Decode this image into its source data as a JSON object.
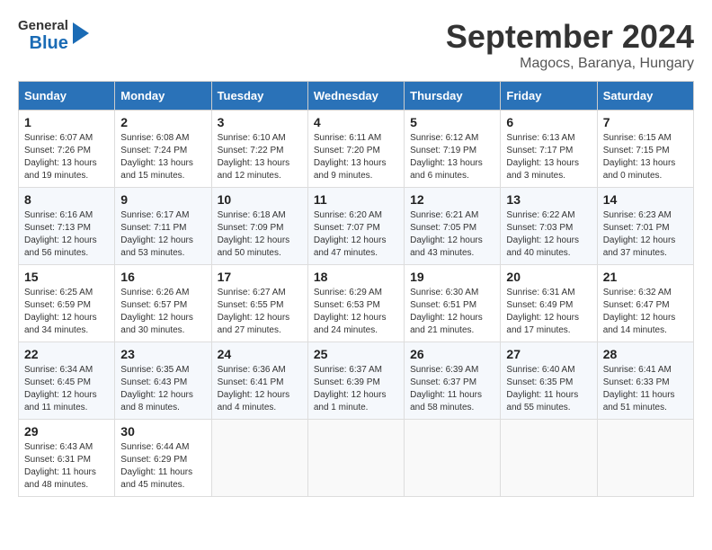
{
  "header": {
    "logo_general": "General",
    "logo_blue": "Blue",
    "month_title": "September 2024",
    "subtitle": "Magocs, Baranya, Hungary"
  },
  "columns": [
    "Sunday",
    "Monday",
    "Tuesday",
    "Wednesday",
    "Thursday",
    "Friday",
    "Saturday"
  ],
  "weeks": [
    [
      {
        "day": "1",
        "info": "Sunrise: 6:07 AM\nSunset: 7:26 PM\nDaylight: 13 hours\nand 19 minutes."
      },
      {
        "day": "2",
        "info": "Sunrise: 6:08 AM\nSunset: 7:24 PM\nDaylight: 13 hours\nand 15 minutes."
      },
      {
        "day": "3",
        "info": "Sunrise: 6:10 AM\nSunset: 7:22 PM\nDaylight: 13 hours\nand 12 minutes."
      },
      {
        "day": "4",
        "info": "Sunrise: 6:11 AM\nSunset: 7:20 PM\nDaylight: 13 hours\nand 9 minutes."
      },
      {
        "day": "5",
        "info": "Sunrise: 6:12 AM\nSunset: 7:19 PM\nDaylight: 13 hours\nand 6 minutes."
      },
      {
        "day": "6",
        "info": "Sunrise: 6:13 AM\nSunset: 7:17 PM\nDaylight: 13 hours\nand 3 minutes."
      },
      {
        "day": "7",
        "info": "Sunrise: 6:15 AM\nSunset: 7:15 PM\nDaylight: 13 hours\nand 0 minutes."
      }
    ],
    [
      {
        "day": "8",
        "info": "Sunrise: 6:16 AM\nSunset: 7:13 PM\nDaylight: 12 hours\nand 56 minutes."
      },
      {
        "day": "9",
        "info": "Sunrise: 6:17 AM\nSunset: 7:11 PM\nDaylight: 12 hours\nand 53 minutes."
      },
      {
        "day": "10",
        "info": "Sunrise: 6:18 AM\nSunset: 7:09 PM\nDaylight: 12 hours\nand 50 minutes."
      },
      {
        "day": "11",
        "info": "Sunrise: 6:20 AM\nSunset: 7:07 PM\nDaylight: 12 hours\nand 47 minutes."
      },
      {
        "day": "12",
        "info": "Sunrise: 6:21 AM\nSunset: 7:05 PM\nDaylight: 12 hours\nand 43 minutes."
      },
      {
        "day": "13",
        "info": "Sunrise: 6:22 AM\nSunset: 7:03 PM\nDaylight: 12 hours\nand 40 minutes."
      },
      {
        "day": "14",
        "info": "Sunrise: 6:23 AM\nSunset: 7:01 PM\nDaylight: 12 hours\nand 37 minutes."
      }
    ],
    [
      {
        "day": "15",
        "info": "Sunrise: 6:25 AM\nSunset: 6:59 PM\nDaylight: 12 hours\nand 34 minutes."
      },
      {
        "day": "16",
        "info": "Sunrise: 6:26 AM\nSunset: 6:57 PM\nDaylight: 12 hours\nand 30 minutes."
      },
      {
        "day": "17",
        "info": "Sunrise: 6:27 AM\nSunset: 6:55 PM\nDaylight: 12 hours\nand 27 minutes."
      },
      {
        "day": "18",
        "info": "Sunrise: 6:29 AM\nSunset: 6:53 PM\nDaylight: 12 hours\nand 24 minutes."
      },
      {
        "day": "19",
        "info": "Sunrise: 6:30 AM\nSunset: 6:51 PM\nDaylight: 12 hours\nand 21 minutes."
      },
      {
        "day": "20",
        "info": "Sunrise: 6:31 AM\nSunset: 6:49 PM\nDaylight: 12 hours\nand 17 minutes."
      },
      {
        "day": "21",
        "info": "Sunrise: 6:32 AM\nSunset: 6:47 PM\nDaylight: 12 hours\nand 14 minutes."
      }
    ],
    [
      {
        "day": "22",
        "info": "Sunrise: 6:34 AM\nSunset: 6:45 PM\nDaylight: 12 hours\nand 11 minutes."
      },
      {
        "day": "23",
        "info": "Sunrise: 6:35 AM\nSunset: 6:43 PM\nDaylight: 12 hours\nand 8 minutes."
      },
      {
        "day": "24",
        "info": "Sunrise: 6:36 AM\nSunset: 6:41 PM\nDaylight: 12 hours\nand 4 minutes."
      },
      {
        "day": "25",
        "info": "Sunrise: 6:37 AM\nSunset: 6:39 PM\nDaylight: 12 hours\nand 1 minute."
      },
      {
        "day": "26",
        "info": "Sunrise: 6:39 AM\nSunset: 6:37 PM\nDaylight: 11 hours\nand 58 minutes."
      },
      {
        "day": "27",
        "info": "Sunrise: 6:40 AM\nSunset: 6:35 PM\nDaylight: 11 hours\nand 55 minutes."
      },
      {
        "day": "28",
        "info": "Sunrise: 6:41 AM\nSunset: 6:33 PM\nDaylight: 11 hours\nand 51 minutes."
      }
    ],
    [
      {
        "day": "29",
        "info": "Sunrise: 6:43 AM\nSunset: 6:31 PM\nDaylight: 11 hours\nand 48 minutes."
      },
      {
        "day": "30",
        "info": "Sunrise: 6:44 AM\nSunset: 6:29 PM\nDaylight: 11 hours\nand 45 minutes."
      },
      {
        "day": "",
        "info": ""
      },
      {
        "day": "",
        "info": ""
      },
      {
        "day": "",
        "info": ""
      },
      {
        "day": "",
        "info": ""
      },
      {
        "day": "",
        "info": ""
      }
    ]
  ]
}
